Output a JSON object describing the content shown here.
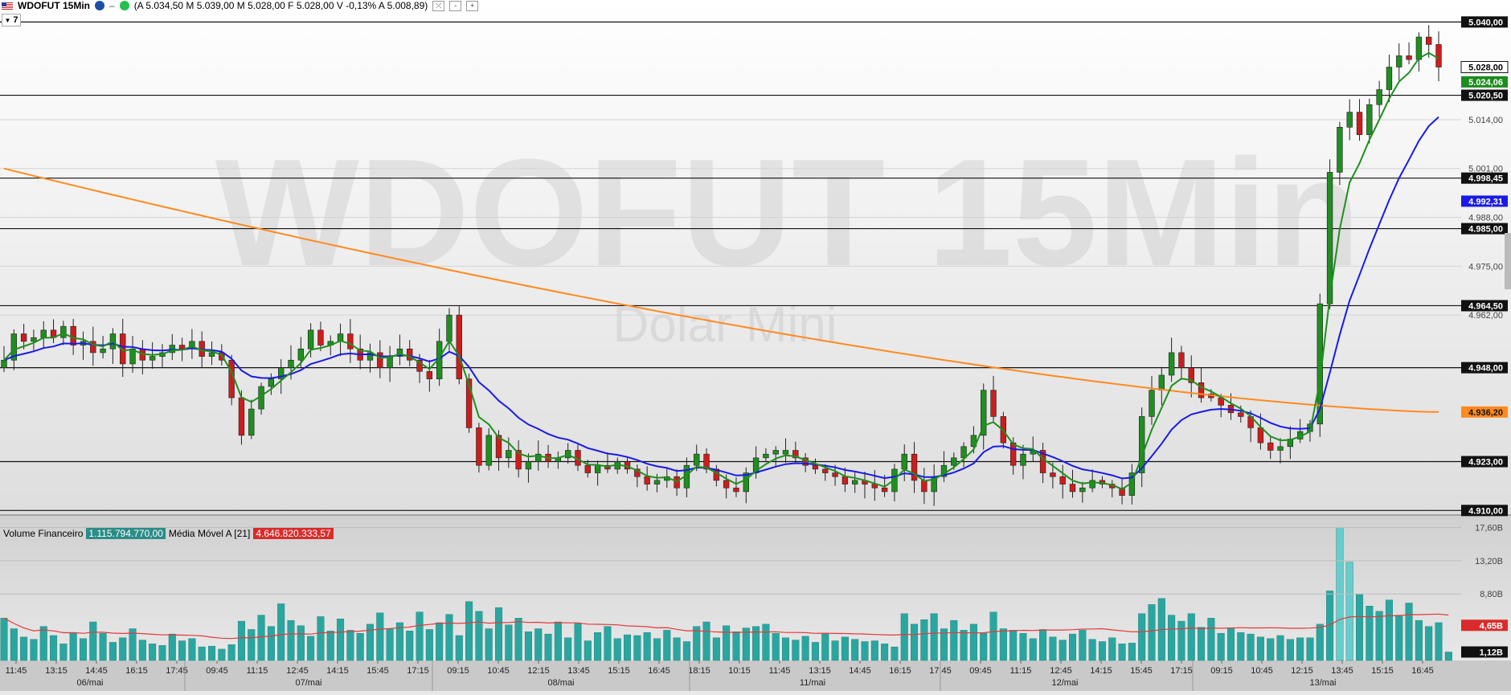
{
  "header": {
    "symbol": "WDOFUT 15Min",
    "quote": "(A 5.034,50 M 5.039,00 M 5.028,00 F 5.028,00 V -0,13% A 5.008,89)",
    "buttons": [
      "⤫",
      "◦",
      "+"
    ]
  },
  "dropdown_value": "7",
  "watermark": {
    "main": "WDOFUT 15Min",
    "sub": "Dolar Mini"
  },
  "volume_legend": {
    "label": "Volume Financeiro",
    "value": "1.115.794.770,00",
    "ma_label": "Média Móvel A [21]",
    "ma_value": "4.646.820.333,57"
  },
  "colors": {
    "bull": "#1f8f1f",
    "bear": "#cc1d1d",
    "ema_fast": "#1f8f1f",
    "ema_mid": "#1a1ae6",
    "ema_slow": "#ff8a1f",
    "volume": "#2aa6a0",
    "volume_ma": "#e23b3b",
    "volume_highlight": "#66cdcd"
  },
  "chart_data": [
    {
      "type": "candlestick",
      "title": "WDOFUT 15Min",
      "ylim": [
        4909,
        5042
      ],
      "price_labels": [
        {
          "value": 5040.0,
          "text": "5.040,00",
          "style": "black"
        },
        {
          "value": 5028.0,
          "text": "5.028,00",
          "style": "black-outline"
        },
        {
          "value": 5024.06,
          "text": "5.024,06",
          "style": "green"
        },
        {
          "value": 5020.5,
          "text": "5.020,50",
          "style": "black"
        },
        {
          "value": 5014.0,
          "text": "5.014,00",
          "style": "plain"
        },
        {
          "value": 5001.0,
          "text": "5.001,00",
          "style": "plain"
        },
        {
          "value": 4998.45,
          "text": "4.998,45",
          "style": "black"
        },
        {
          "value": 4992.31,
          "text": "4.992,31",
          "style": "blue"
        },
        {
          "value": 4988.0,
          "text": "4.988,00",
          "style": "plain"
        },
        {
          "value": 4985.0,
          "text": "4.985,00",
          "style": "black"
        },
        {
          "value": 4975.0,
          "text": "4.975,00",
          "style": "plain"
        },
        {
          "value": 4964.5,
          "text": "4.964,50",
          "style": "black"
        },
        {
          "value": 4962.0,
          "text": "4.962,00",
          "style": "plain"
        },
        {
          "value": 4948.0,
          "text": "4.948,00",
          "style": "black"
        },
        {
          "value": 4936.2,
          "text": "4.936,20",
          "style": "orange"
        },
        {
          "value": 4923.0,
          "text": "4.923,00",
          "style": "black"
        },
        {
          "value": 4910.0,
          "text": "4.910,00",
          "style": "black"
        }
      ],
      "horizontal_levels": [
        5040.0,
        5020.5,
        4998.45,
        4985.0,
        4964.5,
        4948.0,
        4923.0,
        4910.0
      ],
      "ohlc_close_path": [
        4950,
        4957,
        4955,
        4956,
        4958,
        4956,
        4959,
        4954,
        4955,
        4952,
        4953,
        4957,
        4949,
        4953,
        4950,
        4951,
        4952,
        4954,
        4953,
        4955,
        4951,
        4952,
        4950,
        4940,
        4930,
        4937,
        4943,
        4945,
        4948,
        4950,
        4953,
        4958,
        4954,
        4955,
        4957,
        4953,
        4950,
        4952,
        4948,
        4951,
        4953,
        4950,
        4947,
        4945,
        4955,
        4962,
        4945,
        4932,
        4922,
        4930,
        4924,
        4926,
        4921,
        4923,
        4925,
        4923,
        4924,
        4926,
        4922,
        4920,
        4922,
        4921,
        4923,
        4921,
        4919,
        4917,
        4918,
        4919,
        4916,
        4922,
        4925,
        4921,
        4918,
        4916,
        4915,
        4920,
        4924,
        4925,
        4926,
        4926,
        4924,
        4922,
        4921,
        4920,
        4919,
        4917,
        4918,
        4917,
        4916,
        4915,
        4921,
        4925,
        4918,
        4915,
        4919,
        4922,
        4924,
        4927,
        4930,
        4942,
        4935,
        4928,
        4922,
        4925,
        4926,
        4920,
        4919,
        4917,
        4915,
        4916,
        4918,
        4917,
        4916,
        4914,
        4920,
        4935,
        4942,
        4946,
        4952,
        4948,
        4944,
        4940,
        4940,
        4938,
        4936,
        4935,
        4932,
        4928,
        4926,
        4927,
        4929,
        4931,
        4933,
        4965,
        5000,
        5012,
        5016,
        5010,
        5018,
        5022,
        5028,
        5031,
        5030,
        5036,
        5034,
        5028
      ],
      "indicators": [
        {
          "name": "ema_fast",
          "color": "green",
          "last": 5024.06
        },
        {
          "name": "ema_mid",
          "color": "blue",
          "last": 4992.31
        },
        {
          "name": "ema_slow",
          "color": "orange",
          "start": 5001.0,
          "last": 4936.2
        }
      ],
      "x_ticks": [
        "11:45",
        "13:15",
        "14:45",
        "16:15",
        "17:45",
        "09:45",
        "11:15",
        "12:45",
        "14:15",
        "15:45",
        "17:15",
        "09:15",
        "10:45",
        "12:15",
        "13:45",
        "15:15",
        "16:45",
        "18:15",
        "10:15",
        "11:45",
        "13:15",
        "14:45",
        "16:15",
        "17:45",
        "09:45",
        "11:15",
        "12:45",
        "14:15",
        "15:45",
        "17:15",
        "09:15",
        "10:45",
        "12:15",
        "13:45",
        "15:15",
        "16:45"
      ],
      "date_labels": [
        "06/mai",
        "07/mai",
        "08/mai",
        "11/mai",
        "12/mai",
        "13/mai"
      ]
    },
    {
      "type": "bar",
      "title": "Volume Financeiro",
      "ylim": [
        0,
        18.5
      ],
      "y_ticks": [
        {
          "value": 17.6,
          "text": "17,60B"
        },
        {
          "value": 13.2,
          "text": "13,20B"
        },
        {
          "value": 8.8,
          "text": "8,80B"
        },
        {
          "value": 4.65,
          "text": "4,65B",
          "style": "red"
        },
        {
          "value": 1.12,
          "text": "1,12B",
          "style": "black"
        }
      ],
      "values_billions": [
        5.6,
        4.2,
        3.1,
        2.8,
        4.5,
        3.3,
        2.2,
        3.7,
        2.9,
        5.1,
        3.6,
        2.4,
        3.0,
        4.2,
        2.7,
        2.2,
        2.0,
        3.5,
        2.6,
        2.9,
        1.8,
        1.9,
        1.5,
        2.1,
        5.2,
        4.1,
        6.0,
        4.5,
        7.5,
        5.3,
        4.6,
        3.2,
        5.8,
        3.9,
        5.5,
        4.0,
        3.6,
        4.8,
        6.3,
        4.2,
        5.0,
        3.9,
        6.4,
        4.1,
        5.0,
        6.1,
        3.3,
        7.8,
        6.5,
        4.2,
        7.0,
        4.7,
        5.6,
        3.8,
        4.2,
        3.5,
        5.1,
        3.0,
        4.9,
        2.6,
        3.7,
        4.5,
        2.9,
        3.4,
        3.3,
        3.7,
        2.9,
        4.0,
        3.0,
        2.5,
        4.5,
        5.1,
        3.0,
        4.6,
        3.8,
        4.3,
        4.5,
        4.8,
        3.6,
        3.0,
        2.7,
        3.2,
        2.4,
        3.5,
        2.6,
        3.1,
        2.8,
        2.5,
        2.6,
        2.2,
        1.8,
        6.2,
        4.8,
        5.4,
        6.2,
        4.2,
        5.3,
        4.0,
        4.8,
        3.6,
        6.4,
        4.2,
        4.0,
        3.6,
        2.9,
        4.1,
        3.1,
        2.7,
        3.5,
        4.0,
        2.8,
        2.5,
        3.0,
        2.2,
        2.3,
        6.2,
        7.4,
        8.2,
        6.0,
        5.2,
        6.2,
        4.4,
        5.6,
        3.6,
        4.3,
        3.7,
        3.5,
        3.1,
        2.9,
        3.3,
        2.8,
        3.0,
        3.0,
        4.8,
        9.2,
        17.6,
        13.0,
        8.8,
        7.2,
        6.5,
        8.0,
        6.0,
        7.6,
        5.3,
        4.5,
        5.0,
        1.12
      ],
      "moving_average_last": 4.65
    }
  ]
}
